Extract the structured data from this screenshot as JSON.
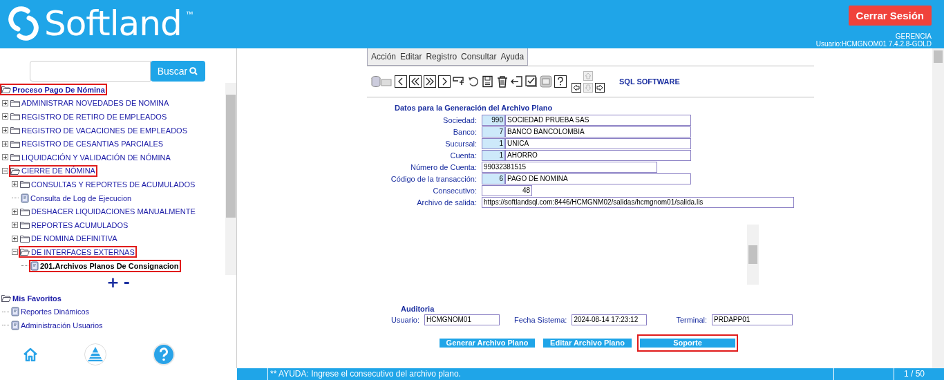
{
  "header": {
    "brand": "Softland",
    "trademark": "™",
    "logout_button": "Cerrar Sesión",
    "role": "GERENCIA",
    "user_info": "Usuario:HCMGNOM01 7.4.2.8-GOLD"
  },
  "sidebar": {
    "search_button": "Buscar",
    "tree": [
      {
        "label": "Proceso Pago De Nómina",
        "kind": "folder",
        "expanded": true,
        "selected": false,
        "highlighted": true,
        "children": [
          {
            "label": "ADMINISTRAR NOVEDADES DE NOMINA",
            "kind": "folder",
            "expanded": false,
            "selected": false,
            "highlighted": false
          },
          {
            "label": "REGISTRO DE RETIRO DE EMPLEADOS",
            "kind": "folder",
            "expanded": false,
            "selected": false,
            "highlighted": false
          },
          {
            "label": "REGISTRO DE VACACIONES DE EMPLEADOS",
            "kind": "folder",
            "expanded": false,
            "selected": false,
            "highlighted": false
          },
          {
            "label": "REGISTRO DE CESANTIAS PARCIALES",
            "kind": "folder",
            "expanded": false,
            "selected": false,
            "highlighted": false
          },
          {
            "label": "LIQUIDACIÓN Y VALIDACIÓN DE NÓMINA",
            "kind": "folder",
            "expanded": false,
            "selected": false,
            "highlighted": false
          },
          {
            "label": "CIERRE DE NÓMINA",
            "kind": "folder",
            "expanded": true,
            "selected": false,
            "highlighted": true,
            "children": [
              {
                "label": "CONSULTAS Y REPORTES DE ACUMULADOS",
                "kind": "folder",
                "expanded": false,
                "selected": false,
                "highlighted": false
              },
              {
                "label": "Consulta de Log de Ejecucion",
                "kind": "document",
                "selected": false,
                "highlighted": false
              },
              {
                "label": "DESHACER LIQUIDACIONES MANUALMENTE",
                "kind": "folder",
                "expanded": false,
                "selected": false,
                "highlighted": false
              },
              {
                "label": "REPORTES ACUMULADOS",
                "kind": "folder",
                "expanded": false,
                "selected": false,
                "highlighted": false
              },
              {
                "label": "DE NOMINA DEFINITIVA",
                "kind": "folder",
                "expanded": false,
                "selected": false,
                "highlighted": false
              },
              {
                "label": "DE INTERFACES EXTERNAS",
                "kind": "folder",
                "expanded": true,
                "selected": false,
                "highlighted": true,
                "children": [
                  {
                    "label": "201.Archivos Planos De Consignacion",
                    "kind": "document",
                    "selected": true,
                    "highlighted": true
                  }
                ]
              }
            ]
          }
        ]
      }
    ],
    "tree_controls": [
      "+",
      "-"
    ],
    "favorites": [
      {
        "label": "Mis Favoritos",
        "kind": "folder",
        "expanded": true,
        "selected": false,
        "highlighted": false,
        "children": [
          {
            "label": "Reportes Dinámicos",
            "kind": "document",
            "selected": false,
            "highlighted": false
          },
          {
            "label": "Administración Usuarios",
            "kind": "document",
            "selected": false,
            "highlighted": false
          }
        ]
      }
    ]
  },
  "main": {
    "menu": [
      "Acción",
      "Editar",
      "Registro",
      "Consultar",
      "Ayuda"
    ],
    "toolbar_title": "SQL SOFTWARE",
    "arrow_pad": {
      "left": {
        "disabled": false
      },
      "up": {
        "disabled": true
      },
      "down": {
        "disabled": true
      },
      "right": {
        "disabled": false
      }
    },
    "section_title": "Datos para la Generación del Archivo Plano",
    "fields": [
      {
        "kind": "code_desc",
        "label": "Sociedad:",
        "code": "990",
        "value": "SOCIEDAD  PRUEBA SAS"
      },
      {
        "kind": "code_desc",
        "label": "Banco:",
        "code": "7",
        "value": "BANCO BANCOLOMBIA"
      },
      {
        "kind": "code_desc",
        "label": "Sucursal:",
        "code": "1",
        "value": "UNICA"
      },
      {
        "kind": "code_desc",
        "label": "Cuenta:",
        "code": "1",
        "value": "AHORRO"
      },
      {
        "kind": "text",
        "label": "Número de Cuenta:",
        "value": "99032381515"
      },
      {
        "kind": "code_desc",
        "label": "Código de la transacción:",
        "code": "6",
        "value": "PAGO DE NOMINA"
      },
      {
        "kind": "number",
        "label": "Consecutivo:",
        "value": "48"
      },
      {
        "kind": "path",
        "label": "Archivo de salida:",
        "value": "https://softlandsql.com:8446/HCMGNM02/salidas/hcmgnom01/salida.lis"
      }
    ],
    "audit": {
      "title": "Auditoria",
      "fields": [
        {
          "label": "Usuario:",
          "value": "HCMGNOM01"
        },
        {
          "label": "Fecha Sistema:",
          "value": "2024-08-14 17:23:12"
        },
        {
          "label": "Terminal:",
          "value": "PRDAPP01"
        }
      ]
    },
    "buttons": [
      {
        "label": "Generar Archivo Plano",
        "highlighted": false
      },
      {
        "label": "Editar Archivo Plano",
        "highlighted": false
      },
      {
        "label": "Soporte",
        "highlighted": true
      }
    ]
  },
  "status_bar": {
    "message": "** AYUDA: Ingrese el consecutivo del archivo plano.",
    "page": "1 / 50"
  }
}
